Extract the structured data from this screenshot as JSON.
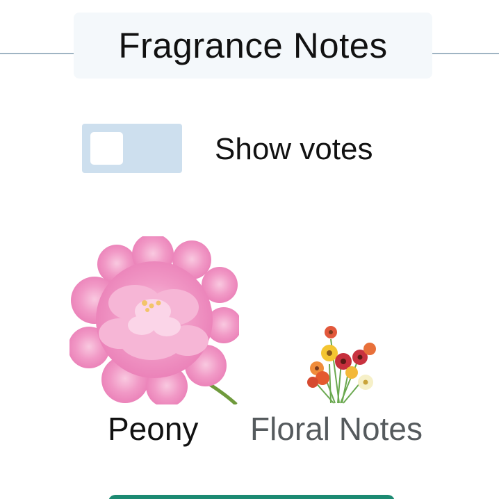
{
  "header": {
    "title": "Fragrance Notes"
  },
  "votes_toggle": {
    "label": "Show votes",
    "checked": false
  },
  "notes": [
    {
      "label": "Peony",
      "image_icon": "peony-flower"
    },
    {
      "label": "Floral Notes",
      "image_icon": "flower-bouquet"
    }
  ],
  "colors": {
    "toggle_track": "#cddfee",
    "title_background": "#f4f8fb",
    "divider": "#9fb4c3",
    "bottom_button": "#1c8a72"
  }
}
